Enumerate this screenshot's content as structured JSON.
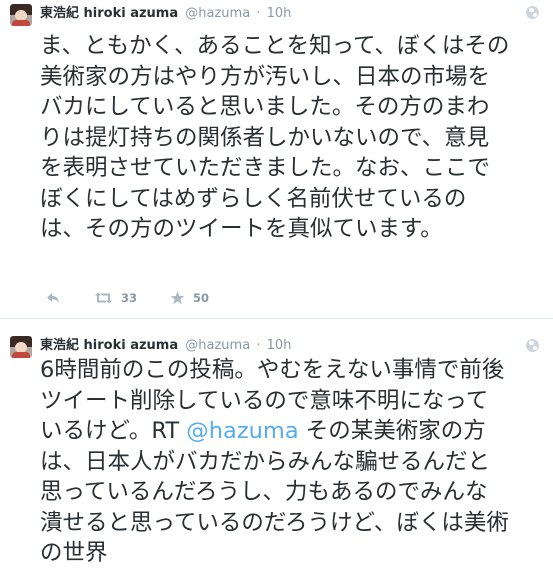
{
  "tweets": [
    {
      "author_name": "東浩紀 hiroki azuma",
      "handle": "@hazuma",
      "separator": "·",
      "time": "10h",
      "text": "ま、ともかく、あることを知って、ぼくはその美術家の方はやり方が汚いし、日本の市場をバカにしていると思いました。その方のまわりは提灯持ちの関係者しかいないので、意見を表明させていただきました。なお、ここでぼくにしてはめずらしく名前伏せているのは、その方のツイートを真似ています。",
      "retweets": "33",
      "favorites": "50"
    },
    {
      "author_name": "東浩紀 hiroki azuma",
      "handle": "@hazuma",
      "separator": "·",
      "time": "10h",
      "text_before": "6時間前のこの投稿。やむをえない事情で前後ツイート削除しているので意味不明になっているけど。RT ",
      "mention": "@hazuma",
      "text_after": " その某美術家の方は、日本人がバカだからみんな騙せるんだと思っているんだろうし、力もあるのでみんな潰せると思っているのだろうけど、ぼくは美術の世界"
    }
  ],
  "icons": {
    "globe": "globe-icon",
    "reply": "reply-icon",
    "retweet": "retweet-icon",
    "favorite": "star-icon"
  },
  "colors": {
    "text": "#292f33",
    "muted": "#8899a6",
    "link": "#55acee",
    "divider": "#e1e8ed"
  }
}
